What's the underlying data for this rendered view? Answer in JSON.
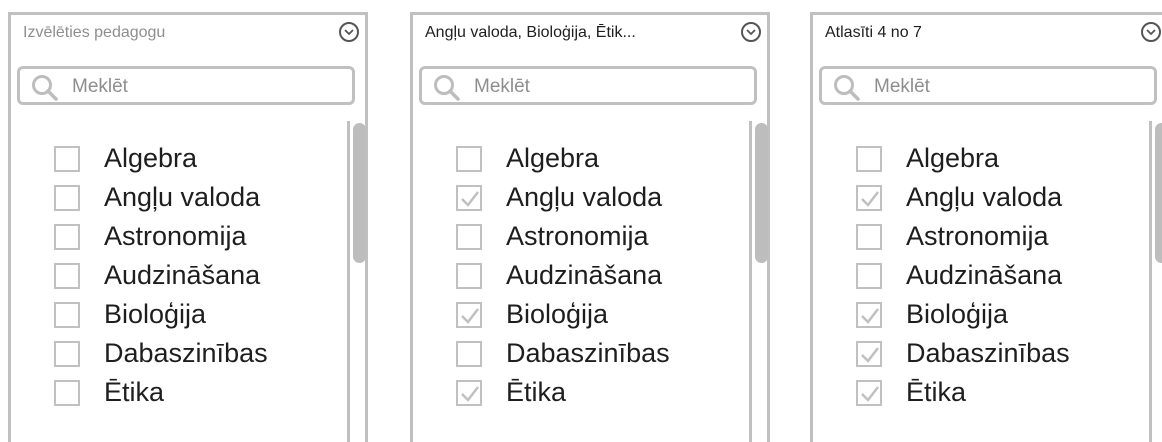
{
  "dropdowns": [
    {
      "header": "Izvēlēties pedagogu",
      "header_is_placeholder": true,
      "search_placeholder": "Meklēt",
      "items": [
        {
          "label": "Algebra",
          "checked": false
        },
        {
          "label": "Angļu valoda",
          "checked": false
        },
        {
          "label": "Astronomija",
          "checked": false
        },
        {
          "label": "Audzināšana",
          "checked": false
        },
        {
          "label": "Bioloģija",
          "checked": false
        },
        {
          "label": "Dabaszinības",
          "checked": false
        },
        {
          "label": "Ētika",
          "checked": false
        }
      ]
    },
    {
      "header": "Angļu valoda, Bioloģija, Ētik...",
      "header_is_placeholder": false,
      "search_placeholder": "Meklēt",
      "items": [
        {
          "label": "Algebra",
          "checked": false
        },
        {
          "label": "Angļu valoda",
          "checked": true
        },
        {
          "label": "Astronomija",
          "checked": false
        },
        {
          "label": "Audzināšana",
          "checked": false
        },
        {
          "label": "Bioloģija",
          "checked": true
        },
        {
          "label": "Dabaszinības",
          "checked": false
        },
        {
          "label": "Ētika",
          "checked": true
        }
      ]
    },
    {
      "header": "Atlasīti 4 no 7",
      "header_is_placeholder": false,
      "search_placeholder": "Meklēt",
      "items": [
        {
          "label": "Algebra",
          "checked": false
        },
        {
          "label": "Angļu valoda",
          "checked": true
        },
        {
          "label": "Astronomija",
          "checked": false
        },
        {
          "label": "Audzināšana",
          "checked": false
        },
        {
          "label": "Bioloģija",
          "checked": true
        },
        {
          "label": "Dabaszinības",
          "checked": true
        },
        {
          "label": "Ētika",
          "checked": true
        }
      ]
    }
  ],
  "icons": {
    "chevron": "chevron-down-icon",
    "search": "search-icon",
    "check": "check-icon"
  },
  "colors": {
    "border": "#c0c0c0",
    "text": "#1e1e1e",
    "placeholder": "#8e8e8e",
    "check": "#c0c0c0"
  }
}
